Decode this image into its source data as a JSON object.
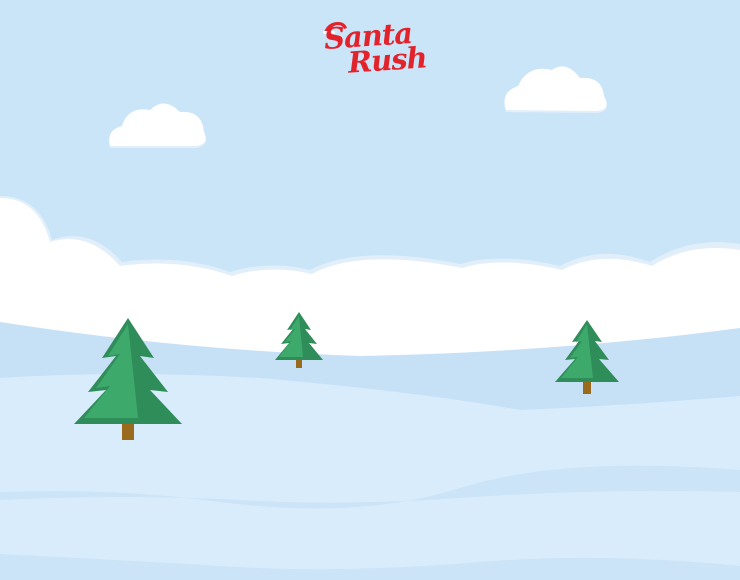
{
  "game": {
    "logo_line1": "Santa",
    "logo_line2": "Rush"
  },
  "colors": {
    "sky": "#cbe5f8",
    "cloud": "#ffffff",
    "cloud_shadow": "#e2effa",
    "snow_light": "#d9ecfb",
    "snow_mid": "#c6e1f6",
    "tree_dark": "#2f8d5a",
    "tree_light": "#3da96b",
    "trunk": "#9a6a1f",
    "logo_red": "#e3232b"
  },
  "icons": [
    "santa-hat-icon",
    "cloud-icon",
    "pine-tree-icon"
  ]
}
